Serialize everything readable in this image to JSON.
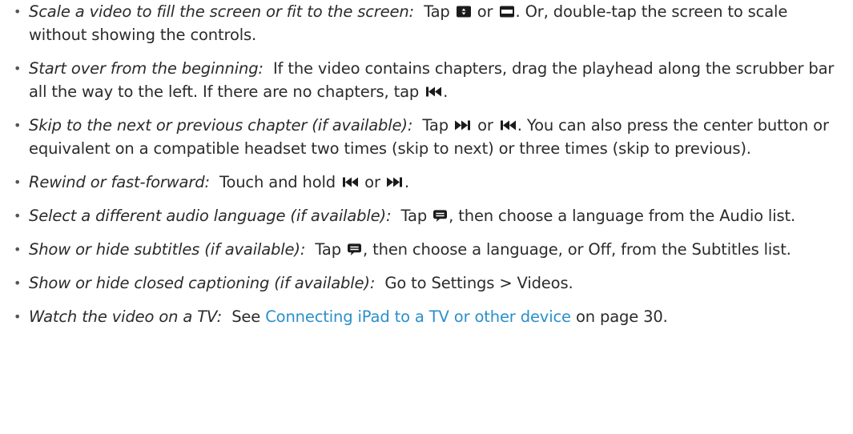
{
  "items": [
    {
      "lead": "Scale a video to fill the screen or fit to the screen:",
      "t1": "Tap",
      "t2": "or",
      "t3": ". Or, double-tap the screen to scale without showing the controls."
    },
    {
      "lead": "Start over from the beginning:",
      "t1": "If the video contains chapters, drag the playhead along the scrubber bar all the way to the left. If there are no chapters, tap",
      "t2": "."
    },
    {
      "lead": "Skip to the next or previous chapter (if available):",
      "t1": "Tap",
      "t2": "or",
      "t3": ". You can also press the center button or equivalent on a compatible headset two times (skip to next) or three times (skip to previous)."
    },
    {
      "lead": "Rewind or fast-forward:",
      "t1": "Touch and hold",
      "t2": "or",
      "t3": "."
    },
    {
      "lead": "Select a different audio language (if available):",
      "t1": "Tap",
      "t2": ", then choose a language from the Audio list."
    },
    {
      "lead": "Show or hide subtitles (if available):",
      "t1": "Tap",
      "t2": ", then choose a language, or Off, from the Subtitles list."
    },
    {
      "lead": "Show or hide closed captioning (if available):",
      "t1": "Go to Settings > Videos."
    },
    {
      "lead": "Watch the video on a TV:",
      "t1": "See",
      "link": "Connecting iPad to a TV or other device",
      "t2": "on page 30."
    }
  ],
  "icons": {
    "accent": "#2a8fc9",
    "names": [
      "scale-fill-icon",
      "scale-fit-icon",
      "skip-back-icon",
      "skip-forward-icon",
      "speech-bubble-icon"
    ]
  }
}
